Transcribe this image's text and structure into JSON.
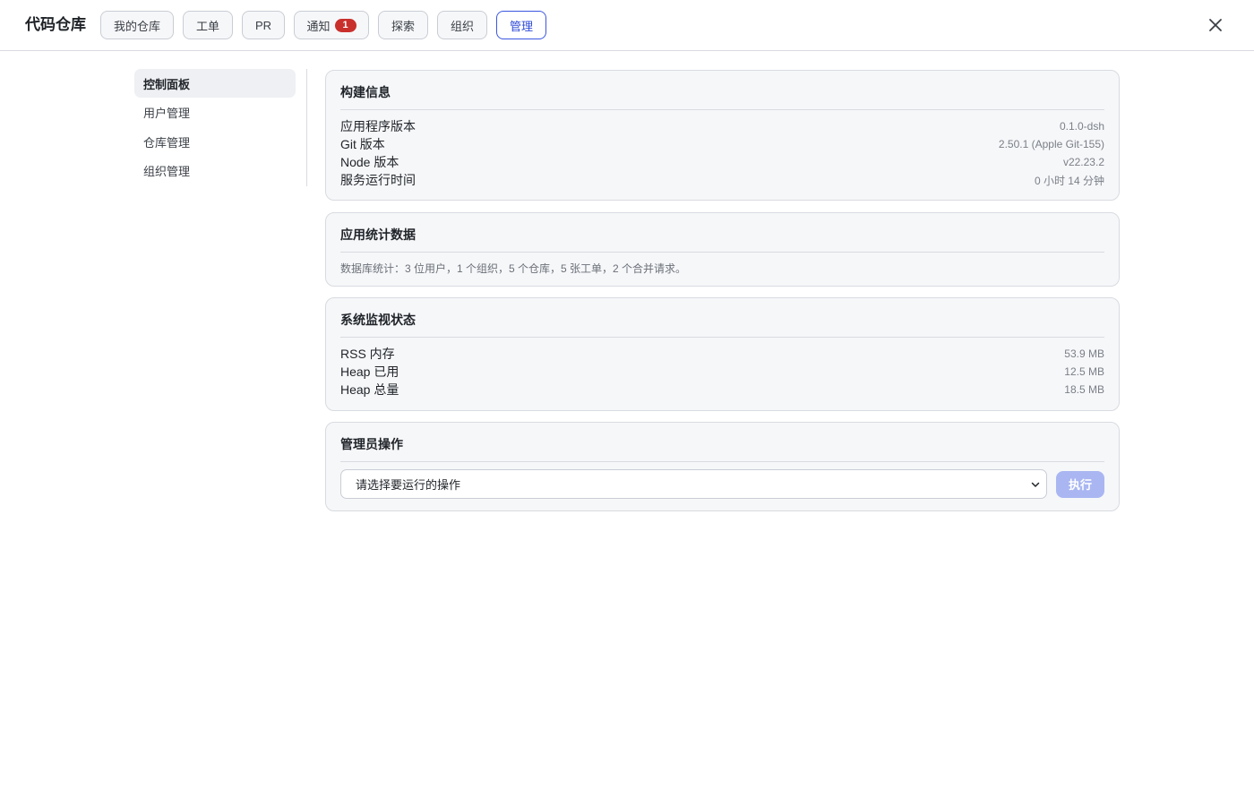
{
  "app": {
    "title": "代码仓库"
  },
  "nav": {
    "tabs": [
      {
        "label": "我的仓库"
      },
      {
        "label": "工单"
      },
      {
        "label": "PR"
      },
      {
        "label": "通知",
        "badge": "1"
      },
      {
        "label": "探索"
      },
      {
        "label": "组织"
      },
      {
        "label": "管理",
        "active": true
      }
    ],
    "close_icon": "close-icon"
  },
  "sidebar": {
    "items": [
      {
        "label": "控制面板",
        "active": true
      },
      {
        "label": "用户管理"
      },
      {
        "label": "仓库管理"
      },
      {
        "label": "组织管理"
      }
    ]
  },
  "build_info": {
    "title": "构建信息",
    "rows": [
      {
        "key": "应用程序版本",
        "value": "0.1.0-dsh"
      },
      {
        "key": "Git 版本",
        "value": "2.50.1 (Apple Git-155)"
      },
      {
        "key": "Node 版本",
        "value": "v22.23.2"
      },
      {
        "key": "服务运行时间",
        "value": "0 小时 14 分钟"
      }
    ]
  },
  "app_stats": {
    "title": "应用统计数据",
    "text": "数据库统计：3 位用户，1 个组织，5 个仓库，5 张工单，2 个合并请求。"
  },
  "system_monitor": {
    "title": "系统监视状态",
    "rows": [
      {
        "key": "RSS 内存",
        "value": "53.9 MB"
      },
      {
        "key": "Heap 已用",
        "value": "12.5 MB"
      },
      {
        "key": "Heap 总量",
        "value": "18.5 MB"
      }
    ]
  },
  "admin_ops": {
    "title": "管理员操作",
    "select_value": "请选择要运行的操作",
    "run_label": "执行"
  },
  "colors": {
    "accent": "#3b57e0",
    "badge": "#c9302c",
    "run_button_disabled": "#a9b6f2"
  }
}
